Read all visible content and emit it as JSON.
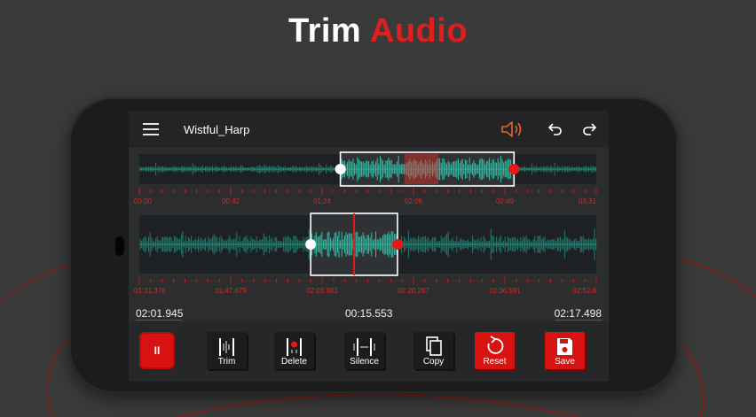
{
  "headline": {
    "word1": "Trim",
    "word2": "Audio"
  },
  "app": {
    "file_name": "Wistful_Harp",
    "colors": {
      "accent": "#e01e1e",
      "wave": "#21c7a8",
      "handle_end": "#e81818",
      "speaker": "#e8632a"
    }
  },
  "overview": {
    "ticks": [
      "00:00",
      "00:42",
      "01:24",
      "02:06",
      "02:49",
      "03:31"
    ],
    "selection": {
      "start": 0.44,
      "end": 0.82
    },
    "playhead_region": {
      "start": 0.58,
      "end": 0.655
    }
  },
  "zoom": {
    "ticks": [
      "01:31.376",
      "01:47.679",
      "02:03.983",
      "02:20.287",
      "02:36.591",
      "02:52.8"
    ],
    "selection": {
      "start": 0.375,
      "end": 0.565
    },
    "playhead": 0.47
  },
  "times": {
    "start": "02:01.945",
    "duration": "00:15.553",
    "end": "02:17.498"
  },
  "toolbar": {
    "pause_label": "II",
    "items": [
      {
        "name": "trim",
        "label": "Trim"
      },
      {
        "name": "delete",
        "label": "Delete"
      },
      {
        "name": "silence",
        "label": "Silence"
      },
      {
        "name": "copy",
        "label": "Copy"
      },
      {
        "name": "reset",
        "label": "Reset"
      },
      {
        "name": "save",
        "label": "Save"
      }
    ]
  }
}
